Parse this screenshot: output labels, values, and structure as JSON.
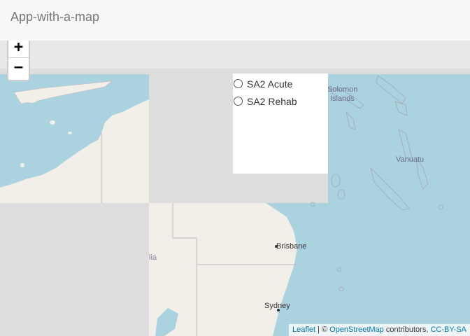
{
  "app": {
    "title": "App-with-a-map"
  },
  "zoom": {
    "in_label": "+",
    "out_label": "−"
  },
  "layers": [
    {
      "label": "SA2 Acute",
      "selected": false
    },
    {
      "label": "SA2 Rehab",
      "selected": false
    }
  ],
  "map_labels": {
    "solomon_line1": "Solomon",
    "solomon_line2": "Islands",
    "vanuatu": "Vanuatu",
    "brisbane": "Brisbane",
    "sydney": "Sydney",
    "australia_partial": "lia"
  },
  "attribution": {
    "leaflet": "Leaflet",
    "separator": " | © ",
    "osm": "OpenStreetMap",
    "contributors": " contributors, ",
    "license": "CC-BY-SA"
  },
  "colors": {
    "water": "#aad3df",
    "land": "#f2efe9",
    "missing_tile": "#dddddd",
    "border": "#c4b6c4"
  }
}
